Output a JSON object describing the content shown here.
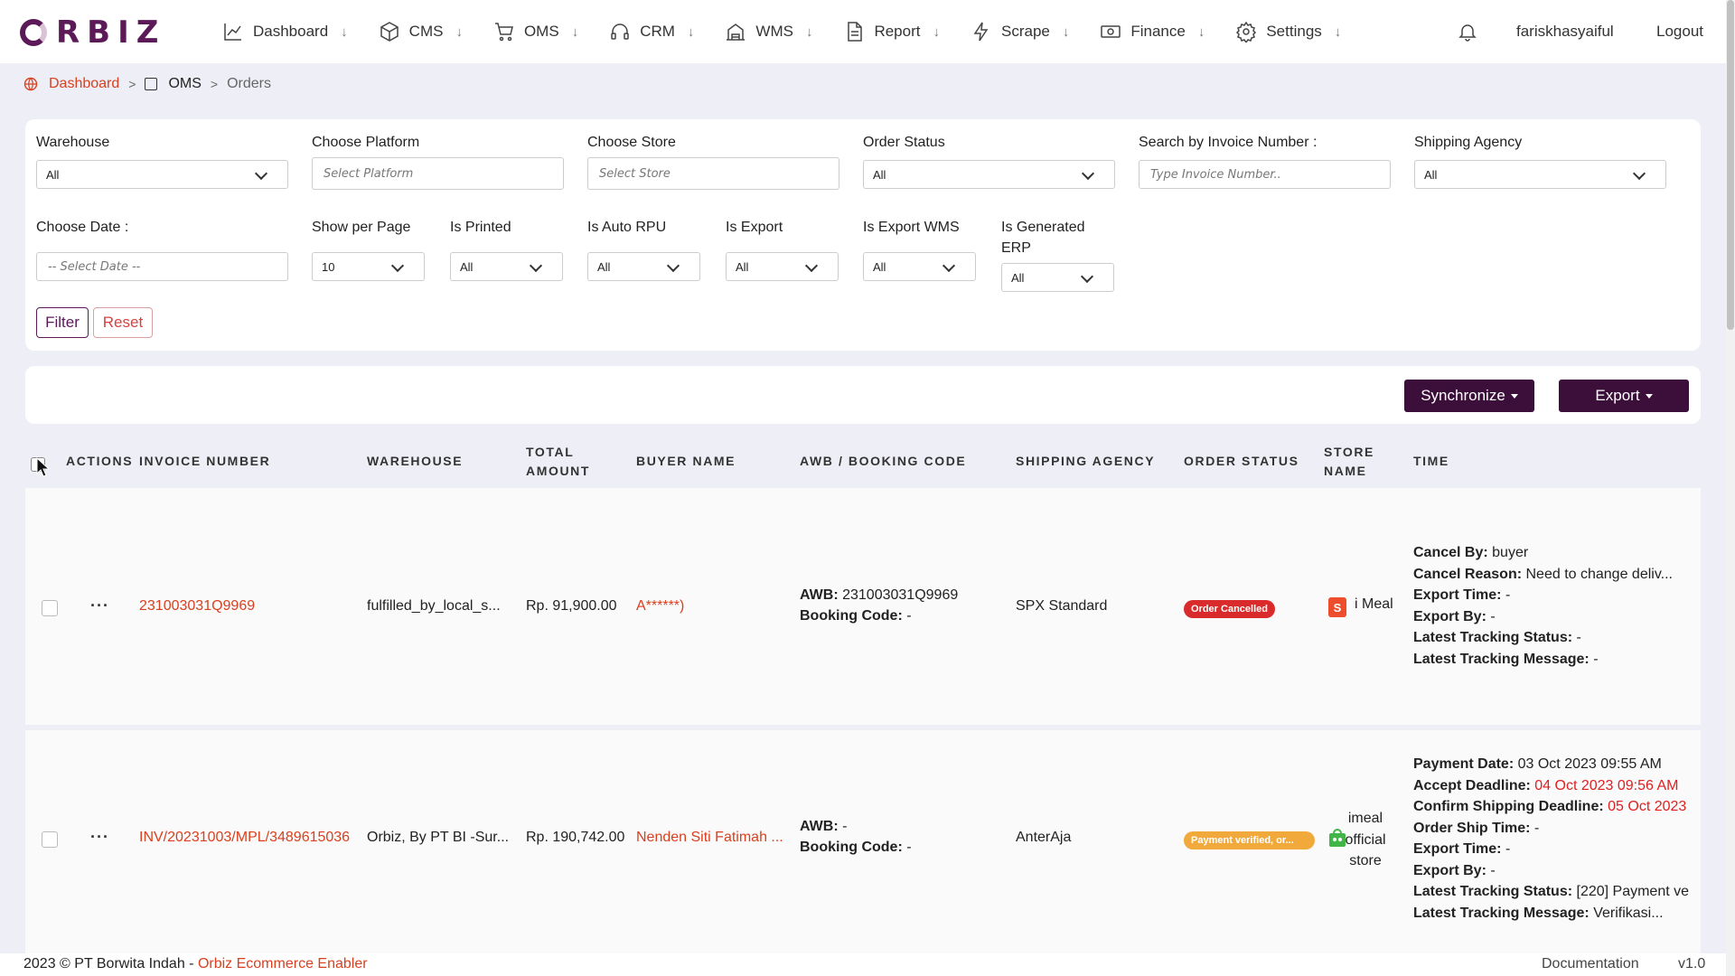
{
  "brand": {
    "logo_text": "RBIZ",
    "accent": "#5b1a57",
    "link_color": "#d9401f"
  },
  "nav": {
    "items": [
      {
        "label": "Dashboard",
        "icon": "chart-line-icon"
      },
      {
        "label": "CMS",
        "icon": "box-icon"
      },
      {
        "label": "OMS",
        "icon": "cart-icon"
      },
      {
        "label": "CRM",
        "icon": "headset-icon"
      },
      {
        "label": "WMS",
        "icon": "warehouse-icon"
      },
      {
        "label": "Report",
        "icon": "document-icon"
      },
      {
        "label": "Scrape",
        "icon": "bolt-icon"
      },
      {
        "label": "Finance",
        "icon": "cash-icon"
      },
      {
        "label": "Settings",
        "icon": "gear-icon"
      }
    ],
    "arrow": "↓",
    "username": "fariskhasyaiful",
    "logout": "Logout"
  },
  "breadcrumb": {
    "root": "Dashboard",
    "section": "OMS",
    "current": "Orders",
    "sep": ">"
  },
  "filters": {
    "warehouse": {
      "label": "Warehouse",
      "value": "All"
    },
    "platform": {
      "label": "Choose Platform",
      "placeholder": "Select Platform"
    },
    "store": {
      "label": "Choose Store",
      "placeholder": "Select Store"
    },
    "order_status": {
      "label": "Order Status",
      "value": "All"
    },
    "invoice": {
      "label": "Search by Invoice Number :",
      "placeholder": "Type Invoice Number.."
    },
    "shipping_agency": {
      "label": "Shipping Agency",
      "value": "All"
    },
    "date": {
      "label": "Choose Date :",
      "placeholder": "-- Select Date --"
    },
    "per_page": {
      "label": "Show per Page",
      "value": "10"
    },
    "is_printed": {
      "label": "Is Printed",
      "value": "All"
    },
    "is_auto_rpu": {
      "label": "Is Auto RPU",
      "value": "All"
    },
    "is_export": {
      "label": "Is Export",
      "value": "All"
    },
    "is_export_wms": {
      "label": "Is Export WMS",
      "value": "All"
    },
    "is_generated_erp": {
      "label_line1": "Is Generated",
      "label_line2": "ERP",
      "value": "All"
    },
    "filter_button": "Filter",
    "reset_button": "Reset"
  },
  "actions": {
    "synchronize": "Synchronize",
    "export": "Export"
  },
  "table": {
    "headers": {
      "actions": "Actions",
      "invoice": "Invoice Number",
      "warehouse": "Warehouse",
      "total_line1": "Total",
      "total_line2": "Amount",
      "buyer": "Buyer Name",
      "awb": "AWB / Booking Code",
      "shipping": "Shipping Agency",
      "status": "Order Status",
      "store_line1": "Store",
      "store_line2": "Name",
      "time": "Time"
    },
    "rows": [
      {
        "actions": "···",
        "invoice": "231003031Q9969",
        "warehouse": "fulfilled_by_local_s...",
        "total": "Rp. 91,900.00",
        "buyer": "A******)",
        "awb_label": "AWB:",
        "awb_value": "231003031Q9969",
        "booking_label": "Booking Code:",
        "booking_value": "-",
        "shipping": "SPX Standard",
        "status": "Order Cancelled",
        "store": "i Meal",
        "store_icon": "shopee-bag-icon",
        "time": [
          {
            "label": "Cancel By:",
            "value": "buyer"
          },
          {
            "label": "Cancel Reason:",
            "value": "Need to change deliv..."
          },
          {
            "label": "Export Time:",
            "value": "-"
          },
          {
            "label": "Export By:",
            "value": "-"
          },
          {
            "label": "Latest Tracking Status:",
            "value": "-"
          },
          {
            "label": "Latest Tracking Message:",
            "value": "-"
          }
        ]
      },
      {
        "actions": "···",
        "invoice": "INV/20231003/MPL/3489615036",
        "warehouse": "Orbiz, By PT BI -Sur...",
        "total": "Rp. 190,742.00",
        "buyer": "Nenden Siti Fatimah ...",
        "awb_label": "AWB:",
        "awb_value": "-",
        "booking_label": "Booking Code:",
        "booking_value": "-",
        "shipping": "AnterAja",
        "status": "Payment verified, or...",
        "store_line1": "imeal",
        "store_line2": "official",
        "store_line3": "store",
        "store_icon": "tokopedia-icon",
        "time": [
          {
            "label": "Payment Date:",
            "value": "03 Oct 2023 09:55 AM"
          },
          {
            "label": "Accept Deadline:",
            "value": "04 Oct 2023 09:56 AM",
            "warn": true
          },
          {
            "label": "Confirm Shipping Deadline:",
            "value": "05 Oct 2023",
            "warn": true
          },
          {
            "label": "Order Ship Time:",
            "value": "-"
          },
          {
            "label": "Export Time:",
            "value": "-"
          },
          {
            "label": "Export By:",
            "value": "-"
          },
          {
            "label": "Latest Tracking Status:",
            "value": "[220] Payment ve"
          },
          {
            "label": "Latest Tracking Message:",
            "value": "Verifikasi..."
          }
        ]
      }
    ]
  },
  "footer": {
    "copyright": "2023 © PT Borwita Indah - ",
    "brand_link": "Orbiz Ecommerce Enabler",
    "documentation": "Documentation",
    "version": "v1.0"
  }
}
